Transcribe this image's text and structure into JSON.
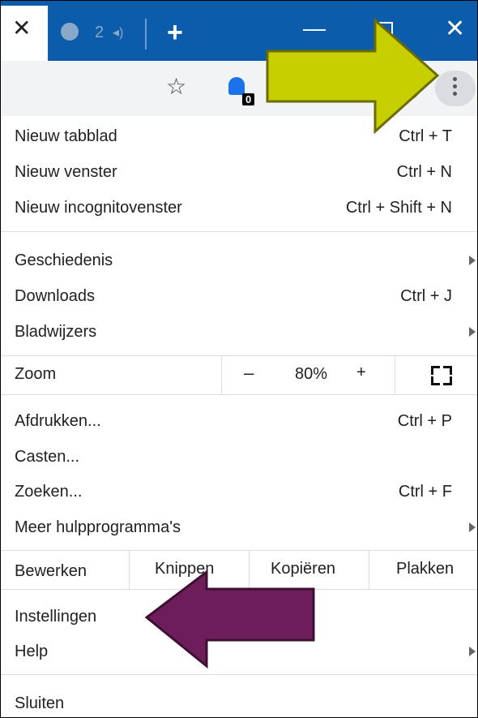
{
  "tabbar": {
    "active_tab_close": "✕",
    "second_tab_number": "2",
    "speaker_glyph": "◂)",
    "new_tab_glyph": "+",
    "minimize_glyph": "—",
    "close_glyph": "✕"
  },
  "toolbar": {
    "star_glyph": "☆",
    "extension_badge": "0"
  },
  "menu": {
    "new_tab": {
      "label": "Nieuw tabblad",
      "shortcut": "Ctrl + T"
    },
    "new_window": {
      "label": "Nieuw venster",
      "shortcut": "Ctrl + N"
    },
    "new_incognito": {
      "label": "Nieuw incognitovenster",
      "shortcut": "Ctrl + Shift + N"
    },
    "history": {
      "label": "Geschiedenis"
    },
    "downloads": {
      "label": "Downloads",
      "shortcut": "Ctrl + J"
    },
    "bookmarks": {
      "label": "Bladwijzers"
    },
    "zoom": {
      "label": "Zoom",
      "minus": "–",
      "value": "80%",
      "plus": "+"
    },
    "print": {
      "label": "Afdrukken...",
      "shortcut": "Ctrl + P"
    },
    "cast": {
      "label": "Casten..."
    },
    "find": {
      "label": "Zoeken...",
      "shortcut": "Ctrl + F"
    },
    "more_tools": {
      "label": "Meer hulpprogramma's"
    },
    "edit": {
      "label": "Bewerken",
      "cut": "Knippen",
      "copy": "Kopiëren",
      "paste": "Plakken"
    },
    "settings": {
      "label": "Instellingen"
    },
    "help": {
      "label": "Help"
    },
    "exit": {
      "label": "Sluiten"
    }
  },
  "annotations": {
    "yellow_arrow_color": "#c8cf00",
    "purple_arrow_color": "#6d1d5a"
  }
}
